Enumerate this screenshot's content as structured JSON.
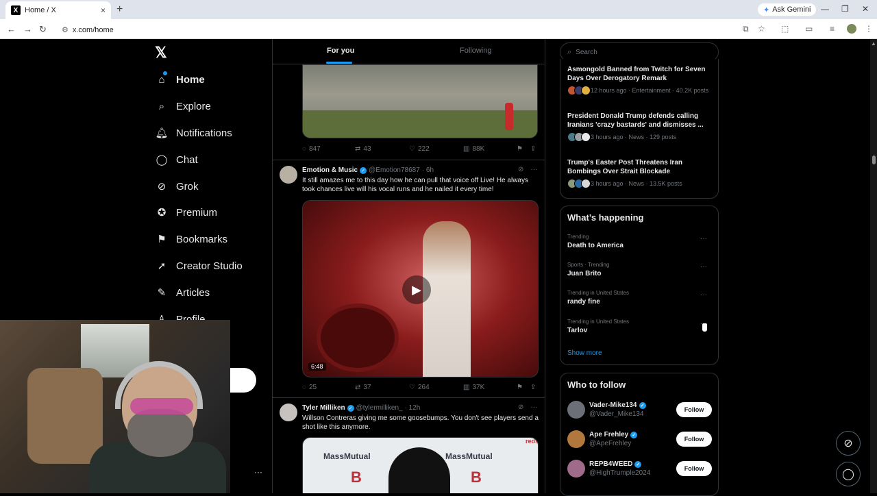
{
  "browser": {
    "tab_title": "Home / X",
    "tab_favicon": "X",
    "tab_close": "×",
    "new_tab": "+",
    "url": "x.com/home",
    "gemini_label": "Ask Gemini",
    "win_min": "—",
    "win_restore": "❐",
    "win_close": "✕"
  },
  "sidebar": {
    "logo": "𝕏",
    "items": [
      {
        "label": "Home",
        "icon": "home-icon"
      },
      {
        "label": "Explore",
        "icon": "search-icon"
      },
      {
        "label": "Notifications",
        "icon": "bell-icon"
      },
      {
        "label": "Chat",
        "icon": "chat-icon"
      },
      {
        "label": "Grok",
        "icon": "grok-icon"
      },
      {
        "label": "Premium",
        "icon": "verified-icon"
      },
      {
        "label": "Bookmarks",
        "icon": "bookmark-icon"
      },
      {
        "label": "Creator Studio",
        "icon": "rocket-icon"
      },
      {
        "label": "Articles",
        "icon": "article-icon"
      },
      {
        "label": "Profile",
        "icon": "person-icon"
      }
    ],
    "more": "···"
  },
  "feed": {
    "tabs": {
      "for_you": "For you",
      "following": "Following"
    },
    "post1_actions": {
      "replies": "847",
      "reposts": "43",
      "likes": "222",
      "views": "88K"
    },
    "post2": {
      "name": "Emotion & Music",
      "handle": "@Emotion78687",
      "time": "· 6h",
      "text": "It still amazes me to this day how he can pull that voice off Live! He always took chances live will his vocal runs and he nailed it every time!",
      "video_duration": "6:48",
      "actions": {
        "replies": "25",
        "reposts": "37",
        "likes": "264",
        "views": "37K"
      }
    },
    "post3": {
      "name": "Tyler Milliken",
      "handle": "@tylermilliken_",
      "time": "· 12h",
      "text": "Willson Contreras giving me some goosebumps. You don't see players send a shot like this anymore.",
      "media_text": "MassMutual",
      "media_text2": "MassMutual",
      "media_text3": "redsox"
    }
  },
  "right": {
    "search_placeholder": "Search",
    "news": [
      {
        "title": "Asmongold Banned from Twitch for Seven Days Over Derogatory Remark",
        "meta": "12 hours ago · Entertainment · 40.2K posts"
      },
      {
        "title": "President Donald Trump defends calling Iranians 'crazy bastards' and dismisses ...",
        "meta": "3 hours ago · News · 129 posts"
      },
      {
        "title": "Trump's Easter Post Threatens Iran Bombings Over Strait Blockade",
        "meta": "3 hours ago · News · 13.5K posts"
      }
    ],
    "happening_title": "What’s happening",
    "trends": [
      {
        "context": "Trending",
        "name": "Death to America"
      },
      {
        "context": "Sports · Trending",
        "name": "Juan Brito"
      },
      {
        "context": "Trending in United States",
        "name": "randy fine"
      },
      {
        "context": "Trending in United States",
        "name": "Tarlov"
      }
    ],
    "show_more": "Show more",
    "wtf_title": "Who to follow",
    "follow": [
      {
        "name": "Vader-Mike134",
        "handle": "@Vader_Mike134",
        "button": "Follow"
      },
      {
        "name": "Ape Frehley",
        "handle": "@ApeFrehley",
        "button": "Follow"
      },
      {
        "name": "REPB4WEED",
        "handle": "@HighTrumple2024",
        "button": "Follow"
      }
    ]
  },
  "colors": {
    "accent": "#1d9bf0",
    "bg": "#000000",
    "text": "#e7e9ea",
    "muted": "#71767b",
    "border": "#2f3336"
  }
}
